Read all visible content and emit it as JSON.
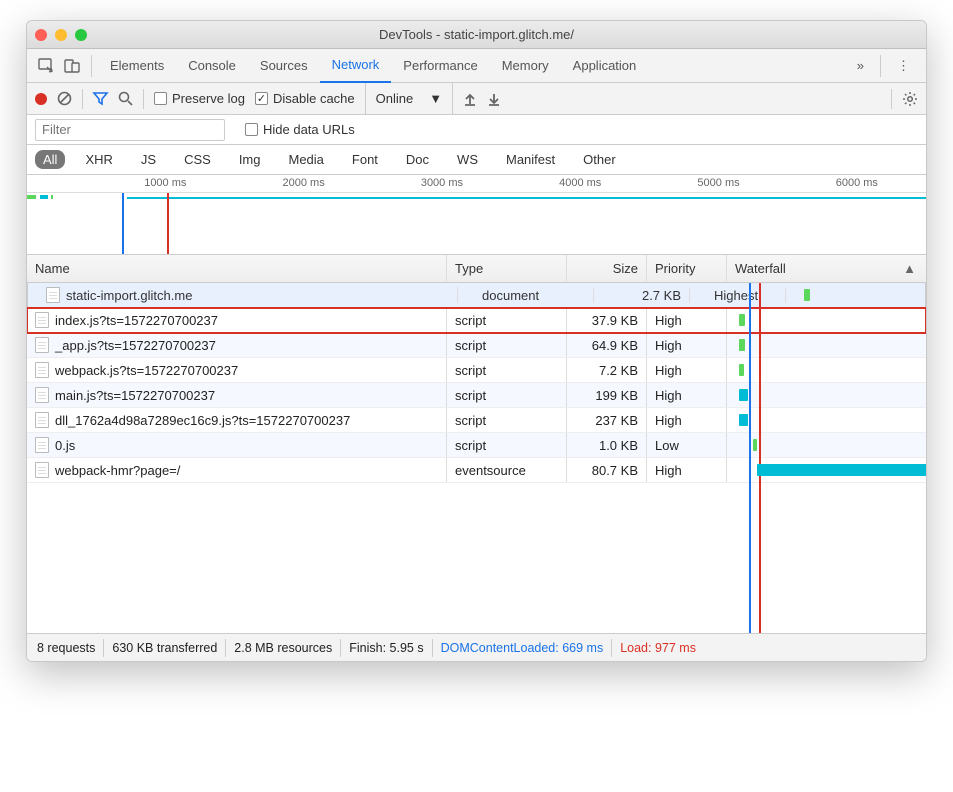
{
  "window_title": "DevTools - static-import.glitch.me/",
  "tabs": [
    "Elements",
    "Console",
    "Sources",
    "Network",
    "Performance",
    "Memory",
    "Application"
  ],
  "active_tab": "Network",
  "toolbar": {
    "preserve_log_label": "Preserve log",
    "preserve_log_checked": false,
    "disable_cache_label": "Disable cache",
    "disable_cache_checked": true,
    "online_label": "Online"
  },
  "filter": {
    "placeholder": "Filter",
    "hide_data_urls_label": "Hide data URLs",
    "hide_data_urls_checked": false
  },
  "type_filters": [
    "All",
    "XHR",
    "JS",
    "CSS",
    "Img",
    "Media",
    "Font",
    "Doc",
    "WS",
    "Manifest",
    "Other"
  ],
  "active_type_filter": "All",
  "timeline_ticks": [
    "1000 ms",
    "2000 ms",
    "3000 ms",
    "4000 ms",
    "5000 ms",
    "6000 ms"
  ],
  "columns": {
    "name": "Name",
    "type": "Type",
    "size": "Size",
    "priority": "Priority",
    "waterfall": "Waterfall"
  },
  "highlighted_row": 1,
  "requests": [
    {
      "name": "static-import.glitch.me",
      "type": "document",
      "size": "2.7 KB",
      "priority": "Highest"
    },
    {
      "name": "index.js?ts=1572270700237",
      "type": "script",
      "size": "37.9 KB",
      "priority": "High"
    },
    {
      "name": "_app.js?ts=1572270700237",
      "type": "script",
      "size": "64.9 KB",
      "priority": "High"
    },
    {
      "name": "webpack.js?ts=1572270700237",
      "type": "script",
      "size": "7.2 KB",
      "priority": "High"
    },
    {
      "name": "main.js?ts=1572270700237",
      "type": "script",
      "size": "199 KB",
      "priority": "High"
    },
    {
      "name": "dll_1762a4d98a7289ec16c9.js?ts=1572270700237",
      "type": "script",
      "size": "237 KB",
      "priority": "High"
    },
    {
      "name": "0.js",
      "type": "script",
      "size": "1.0 KB",
      "priority": "Low"
    },
    {
      "name": "webpack-hmr?page=/",
      "type": "eventsource",
      "size": "80.7 KB",
      "priority": "High"
    }
  ],
  "status": {
    "requests": "8 requests",
    "transferred": "630 KB transferred",
    "resources": "2.8 MB resources",
    "finish": "Finish: 5.95 s",
    "dcl": "DOMContentLoaded: 669 ms",
    "load": "Load: 977 ms"
  }
}
